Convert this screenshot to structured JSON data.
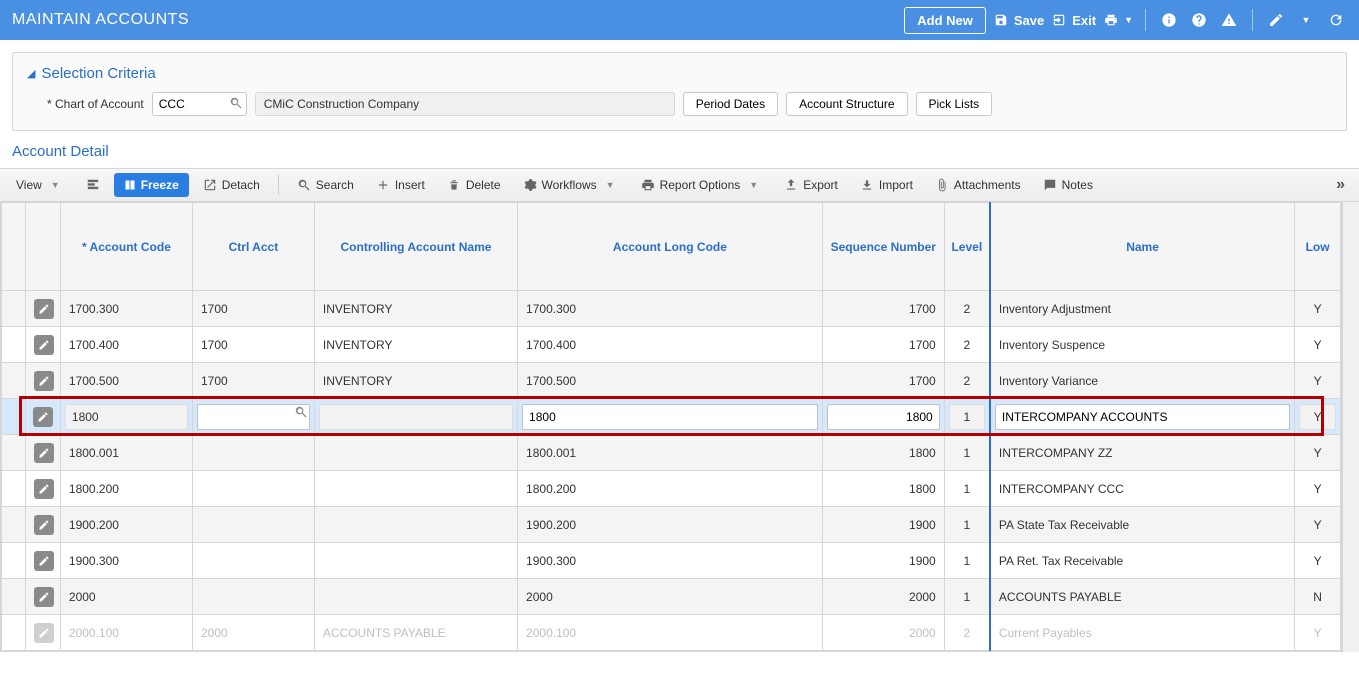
{
  "header": {
    "title": "MAINTAIN ACCOUNTS",
    "addnew": "Add New",
    "save": "Save",
    "exit": "Exit"
  },
  "criteria": {
    "title": "Selection Criteria",
    "chart_label": "Chart of Account",
    "chart_value": "CCC",
    "chart_desc": "CMiC Construction Company",
    "btn_period": "Period Dates",
    "btn_struct": "Account Structure",
    "btn_pick": "Pick Lists"
  },
  "section": {
    "title": "Account Detail"
  },
  "toolbar": {
    "view": "View",
    "freeze": "Freeze",
    "detach": "Detach",
    "search": "Search",
    "insert": "Insert",
    "delete": "Delete",
    "workflows": "Workflows",
    "report": "Report Options",
    "export": "Export",
    "import": "Import",
    "attachments": "Attachments",
    "notes": "Notes"
  },
  "columns": {
    "acct_code": "* Account Code",
    "ctrl_acct": "Ctrl Acct",
    "ctrl_name": "Controlling Account Name",
    "long_code": "Account Long Code",
    "seq": "Sequence Number",
    "level": "Level",
    "name": "Name",
    "low": "Low"
  },
  "rows": [
    {
      "acct_code": "1700.300",
      "ctrl_acct": "1700",
      "ctrl_name": "INVENTORY",
      "long_code": "1700.300",
      "seq": "1700",
      "level": "2",
      "name": "Inventory Adjustment",
      "low": "Y"
    },
    {
      "acct_code": "1700.400",
      "ctrl_acct": "1700",
      "ctrl_name": "INVENTORY",
      "long_code": "1700.400",
      "seq": "1700",
      "level": "2",
      "name": "Inventory Suspence",
      "low": "Y"
    },
    {
      "acct_code": "1700.500",
      "ctrl_acct": "1700",
      "ctrl_name": "INVENTORY",
      "long_code": "1700.500",
      "seq": "1700",
      "level": "2",
      "name": "Inventory Variance",
      "low": "Y"
    },
    {
      "acct_code": "1800",
      "ctrl_acct": "",
      "ctrl_name": "",
      "long_code": "1800",
      "seq": "1800",
      "level": "1",
      "name": "INTERCOMPANY ACCOUNTS",
      "low": "Y",
      "selected": true
    },
    {
      "acct_code": "1800.001",
      "ctrl_acct": "",
      "ctrl_name": "",
      "long_code": "1800.001",
      "seq": "1800",
      "level": "1",
      "name": "INTERCOMPANY ZZ",
      "low": "Y"
    },
    {
      "acct_code": "1800.200",
      "ctrl_acct": "",
      "ctrl_name": "",
      "long_code": "1800.200",
      "seq": "1800",
      "level": "1",
      "name": "INTERCOMPANY CCC",
      "low": "Y"
    },
    {
      "acct_code": "1900.200",
      "ctrl_acct": "",
      "ctrl_name": "",
      "long_code": "1900.200",
      "seq": "1900",
      "level": "1",
      "name": "PA State Tax Receivable",
      "low": "Y"
    },
    {
      "acct_code": "1900.300",
      "ctrl_acct": "",
      "ctrl_name": "",
      "long_code": "1900.300",
      "seq": "1900",
      "level": "1",
      "name": "PA Ret. Tax Receivable",
      "low": "Y"
    },
    {
      "acct_code": "2000",
      "ctrl_acct": "",
      "ctrl_name": "",
      "long_code": "2000",
      "seq": "2000",
      "level": "1",
      "name": "ACCOUNTS PAYABLE",
      "low": "N"
    },
    {
      "acct_code": "2000.100",
      "ctrl_acct": "2000",
      "ctrl_name": "ACCOUNTS PAYABLE",
      "long_code": "2000.100",
      "seq": "2000",
      "level": "2",
      "name": "Current Payables",
      "low": "Y",
      "dim": true
    }
  ]
}
